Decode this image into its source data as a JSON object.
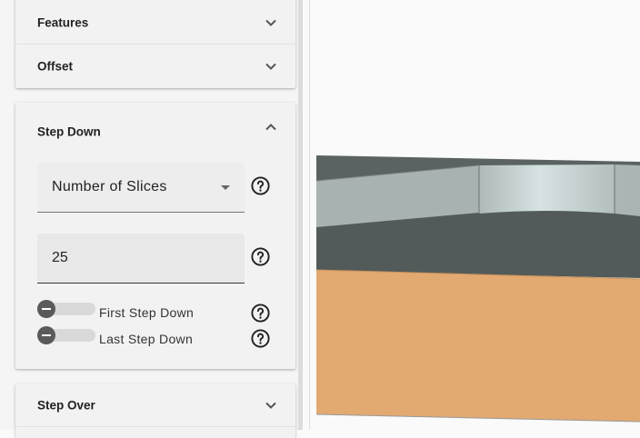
{
  "sections": {
    "features": {
      "title": "Features"
    },
    "offset": {
      "title": "Offset"
    },
    "step_down": {
      "title": "Step Down",
      "mode_select": {
        "selected": "Number of Slices"
      },
      "slices_input": {
        "value": "25"
      },
      "first_step_down": {
        "label": "First Step Down",
        "enabled": false
      },
      "last_step_down": {
        "label": "Last Step Down",
        "enabled": false
      }
    },
    "step_over": {
      "title": "Step Over"
    }
  },
  "colors": {
    "model_top": "#a8b2b1",
    "model_highlight": "#d3dfe0",
    "model_dark": "#525b5a",
    "stock_orange": "#e2a970"
  },
  "icons": [
    "chevron-down-icon",
    "chevron-up-icon",
    "help-circle-icon",
    "dropdown-arrow-icon"
  ]
}
